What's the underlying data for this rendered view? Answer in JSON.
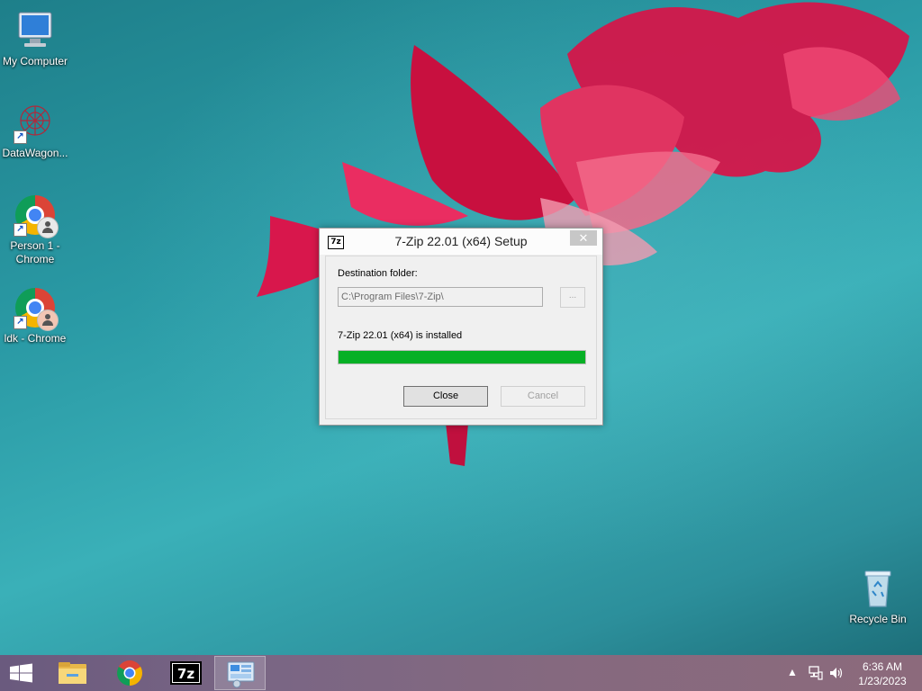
{
  "desktop": {
    "icons": [
      {
        "label": "My Computer",
        "icon": "computer-icon"
      },
      {
        "label": "DataWagon...",
        "icon": "datawagon-icon"
      },
      {
        "label": "Person 1 - Chrome",
        "icon": "chrome-icon"
      },
      {
        "label": "ldk - Chrome",
        "icon": "chrome-icon"
      },
      {
        "label": "Recycle Bin",
        "icon": "recycle-bin-icon"
      }
    ]
  },
  "dialog": {
    "title": "7-Zip 22.01 (x64) Setup",
    "title_icon_text": "7z",
    "close_glyph": "✕",
    "destination_label": "Destination folder:",
    "destination_value": "C:\\Program Files\\7-Zip\\",
    "browse_label": "...",
    "status_text": "7-Zip 22.01 (x64) is installed",
    "progress_percent": 100,
    "progress_color": "#06b025",
    "close_button": "Close",
    "cancel_button": "Cancel"
  },
  "taskbar": {
    "items": [
      "start-icon",
      "file-explorer-icon",
      "chrome-icon",
      "7zip-icon",
      "control-panel-icon"
    ],
    "tray_arrow": "▲",
    "time": "6:36 AM",
    "date": "1/23/2023"
  }
}
